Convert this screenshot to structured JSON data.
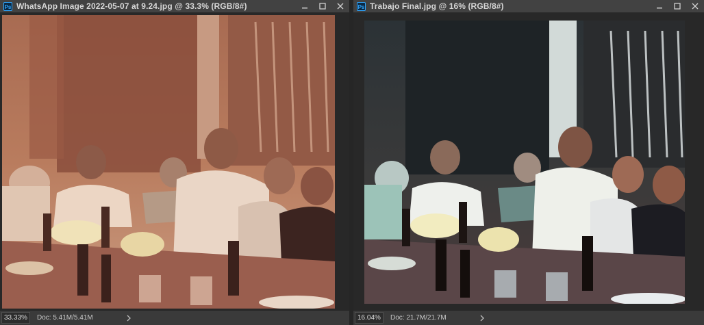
{
  "windows": [
    {
      "title": "WhatsApp Image 2022-05-07 at 9.24.jpg @ 33.3% (RGB/8#)",
      "app_icon": "Ps",
      "zoom": "33.33%",
      "doc_info": "Doc: 5.41M/5.41M"
    },
    {
      "title": "Trabajo Final.jpg @ 16% (RGB/8#)",
      "app_icon": "Ps",
      "zoom": "16.04%",
      "doc_info": "Doc: 21.7M/21.7M"
    }
  ],
  "icons": [
    "photoshop-icon",
    "minimize-icon",
    "maximize-icon",
    "close-icon",
    "chevron-right-icon"
  ],
  "colors": {
    "panel_bg": "#323232",
    "titlebar_bg": "#424242",
    "statusbar_bg": "#3a3a3a",
    "ps_blue": "#31a8ff",
    "original_photo_tone": "#c48a6a",
    "restored_photo_tone": "#2e3438"
  }
}
